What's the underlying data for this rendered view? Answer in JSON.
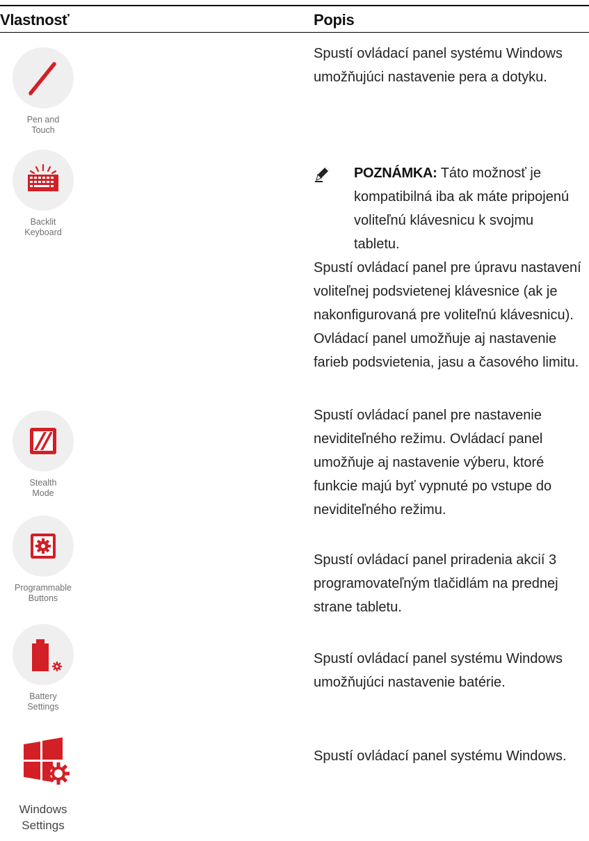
{
  "table": {
    "header": {
      "col1": "Vlastnosť",
      "col2": "Popis"
    }
  },
  "features": [
    {
      "icon": "pen-icon",
      "caption": "Pen and\nTouch"
    },
    {
      "icon": "backlit-keyboard-icon",
      "caption": "Backlit\nKeyboard"
    },
    {
      "icon": "stealth-mode-icon",
      "caption": "Stealth\nMode"
    },
    {
      "icon": "programmable-buttons-icon",
      "caption": "Programmable\nButtons"
    },
    {
      "icon": "battery-settings-icon",
      "caption": "Battery\nSettings"
    },
    {
      "icon": "windows-settings-icon",
      "caption": "Windows\nSettings"
    }
  ],
  "descriptions": {
    "pen_touch": "Spustí ovládací panel systému Windows umožňujúci nastavenie pera a dotyku.",
    "backlit_note_label": "POZNÁMKA:",
    "backlit_note_text": " Táto možnosť je kompatibilná iba ak máte pripojenú voliteľnú klávesnicu k svojmu tabletu.",
    "backlit": "Spustí ovládací panel pre úpravu nastavení voliteľnej podsvietenej klávesnice (ak je nakonfigurovaná pre voliteľnú klávesnicu). Ovládací panel umožňuje aj nastavenie farieb podsvietenia, jasu a časového limitu.",
    "stealth": "Spustí ovládací panel pre nastavenie neviditeľného režimu. Ovládací panel umožňuje aj nastavenie výberu, ktoré funkcie majú byť vypnuté po vstupe do neviditeľného režimu.",
    "programmable": "Spustí ovládací panel priradenia akcií 3 programovateľným tlačidlám na prednej strane tabletu.",
    "battery": "Spustí ovládací panel systému Windows umožňujúci nastavenie batérie.",
    "windows": "Spustí ovládací panel systému Windows."
  },
  "colors": {
    "accent": "#d31f26",
    "circle": "#efefef",
    "caption": "#707070"
  }
}
